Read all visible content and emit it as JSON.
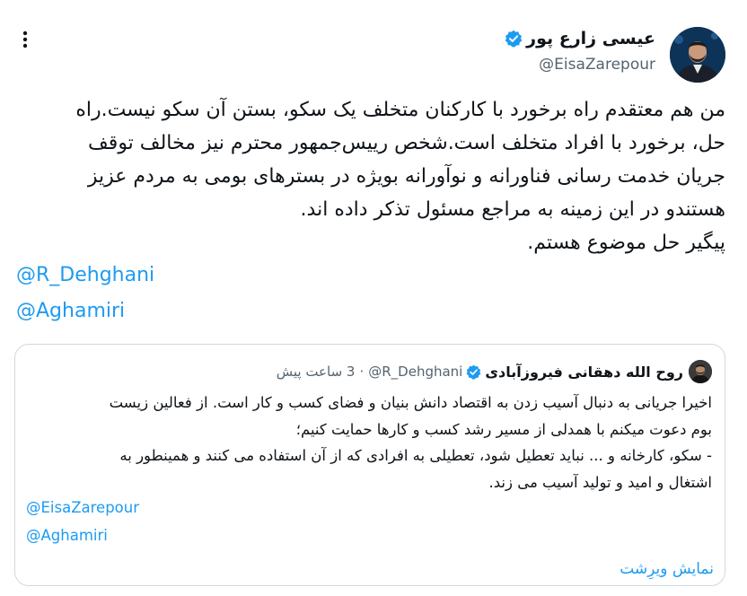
{
  "author": {
    "name": "عیسی زارع پور",
    "handle": "@EisaZarepour",
    "verified": true
  },
  "tweet": {
    "lines": [
      "من هم معتقدم راه برخورد با کارکنان متخلف یک سکو، بستن آن سکو نیست.راه",
      "حل، برخورد با افراد متخلف است.شخص رییس‌جمهور محترم نیز مخالف توقف",
      "جریان خدمت رسانی فناورانه و نوآورانه بویژه در بسترهای بومی به مردم عزیز",
      "هستندو در این زمینه به مراجع مسئول تذکر داده اند.",
      "پیگیر حل موضوع هستم."
    ],
    "mentions": [
      "@R_Dehghani",
      "@Aghamiri"
    ]
  },
  "quote": {
    "name": "روح الله دهقانی فیروزآبادی",
    "handle": "@R_Dehghani",
    "verified": true,
    "separator": "·",
    "time": "3 ساعت پیش",
    "lines": [
      "اخیرا جریانی به دنبال آسیب زدن به اقتصاد دانش بنیان و فضای کسب و کار است. از فعالین زیست",
      "بوم دعوت میکنم با همدلی از مسیر رشد کسب و کارها حمایت کنیم؛",
      "- سکو، کارخانه و ... نباید تعطیل شود، تعطیلی به افرادی که از آن استفاده می کنند و همینطور به",
      "اشتغال و امید و تولید آسیب می زند."
    ],
    "mentions": [
      "@EisaZarepour",
      "@Aghamiri"
    ],
    "show_more": "نمایش ویرِشت"
  },
  "icons": {
    "more": "more-vertical-icon",
    "verified": "verified-badge-icon"
  },
  "colors": {
    "link": "#1d9bf0",
    "text": "#0f1419",
    "muted": "#536471",
    "border": "#cfd9de"
  }
}
